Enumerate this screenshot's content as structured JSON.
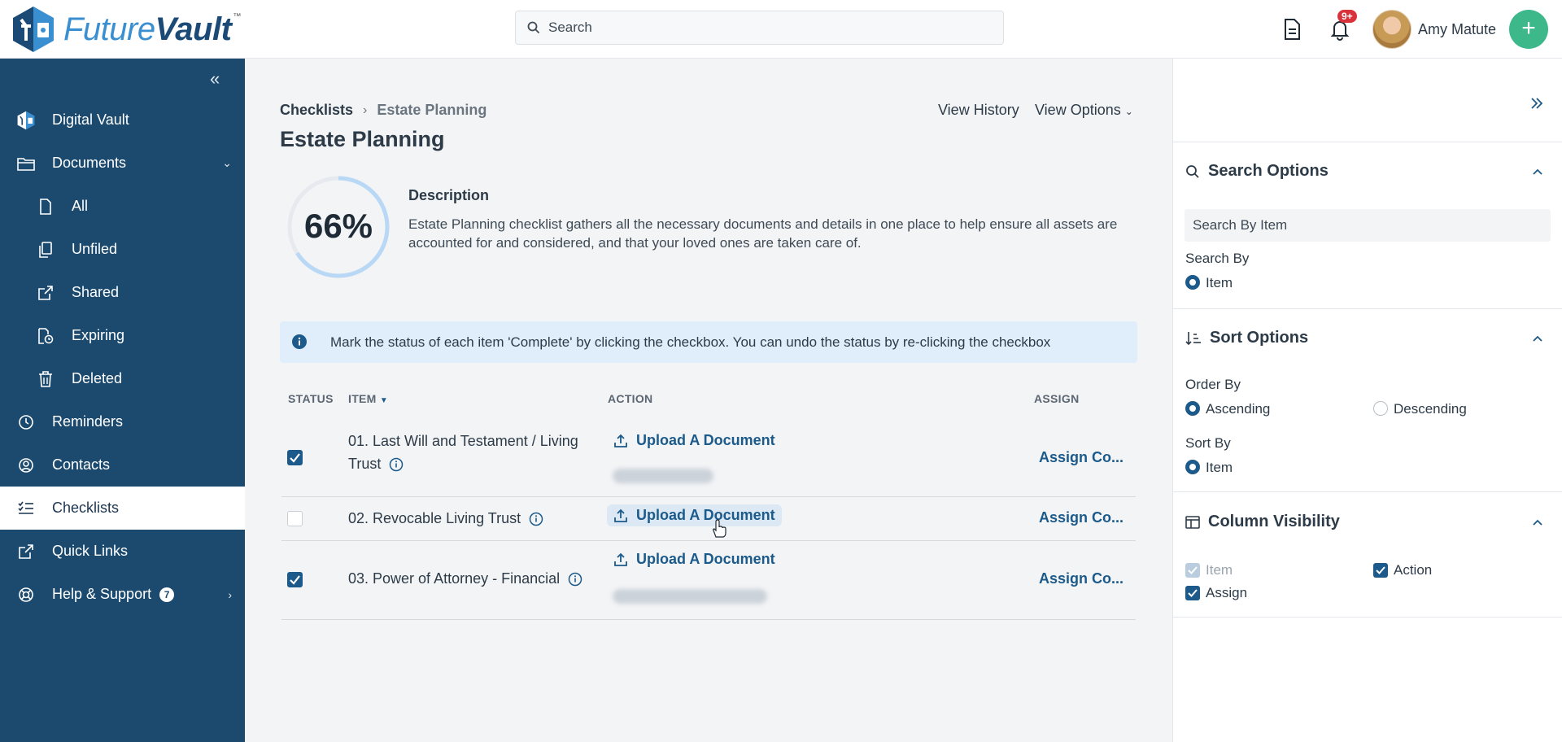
{
  "header": {
    "logo_part1": "Future",
    "logo_part2": "Vault",
    "logo_tm": "™",
    "search_placeholder": "Search",
    "notification_count": "9+",
    "user_name": "Amy Matute",
    "add_label": "+"
  },
  "sidebar": {
    "items": [
      {
        "label": "Digital Vault",
        "icon": "vault-logo-icon"
      },
      {
        "label": "Documents",
        "icon": "folder-icon"
      },
      {
        "label": "All",
        "icon": "file-icon"
      },
      {
        "label": "Unfiled",
        "icon": "copy-icon"
      },
      {
        "label": "Shared",
        "icon": "share-icon"
      },
      {
        "label": "Expiring",
        "icon": "file-clock-icon"
      },
      {
        "label": "Deleted",
        "icon": "trash-icon"
      },
      {
        "label": "Reminders",
        "icon": "clock-icon"
      },
      {
        "label": "Contacts",
        "icon": "user-circle-icon"
      },
      {
        "label": "Checklists",
        "icon": "checklist-icon"
      },
      {
        "label": "Quick Links",
        "icon": "external-link-icon"
      },
      {
        "label": "Help & Support",
        "icon": "lifebuoy-icon"
      }
    ],
    "help_badge": "7"
  },
  "main": {
    "breadcrumb": {
      "root": "Checklists",
      "current": "Estate Planning"
    },
    "view_history": "View History",
    "view_options": "View Options",
    "title": "Estate Planning",
    "progress_percent": 66,
    "progress_label": "66%",
    "description_title": "Description",
    "description": "Estate Planning checklist gathers all the necessary documents and details in one place to help ensure all assets are accounted for and considered, and that your loved ones are taken care of.",
    "info_message": "Mark the status of each item 'Complete' by clicking the checkbox. You can undo the status by re-clicking the checkbox",
    "table": {
      "headers": {
        "status": "STATUS",
        "item": "ITEM",
        "action": "ACTION",
        "assign": "ASSIGN"
      },
      "rows": [
        {
          "checked": true,
          "item_line1": "01. Last Will and Testament / Living",
          "item_line2": "Trust",
          "action": "Upload A Document",
          "assign": "Assign Co..."
        },
        {
          "checked": false,
          "item_line1": "02. Revocable Living Trust",
          "item_line2": "",
          "action": "Upload A Document",
          "assign": "Assign Co..."
        },
        {
          "checked": true,
          "item_line1": "03. Power of Attorney - Financial",
          "item_line2": "",
          "action": "Upload A Document",
          "assign": "Assign Co..."
        }
      ]
    }
  },
  "right_panel": {
    "search_options": {
      "title": "Search Options",
      "input_placeholder": "Search By Item",
      "search_by_label": "Search By",
      "search_by_value": "Item"
    },
    "sort_options": {
      "title": "Sort Options",
      "order_by_label": "Order By",
      "ascending": "Ascending",
      "descending": "Descending",
      "sort_by_label": "Sort By",
      "sort_by_value": "Item"
    },
    "column_visibility": {
      "title": "Column Visibility",
      "item": "Item",
      "action": "Action",
      "assign": "Assign"
    }
  },
  "colors": {
    "sidebar": "#1c4a6e",
    "accent": "#1b5a8a",
    "add_button": "#3cb88a",
    "info_bar": "#e0eefc",
    "badge": "#d9323a"
  }
}
